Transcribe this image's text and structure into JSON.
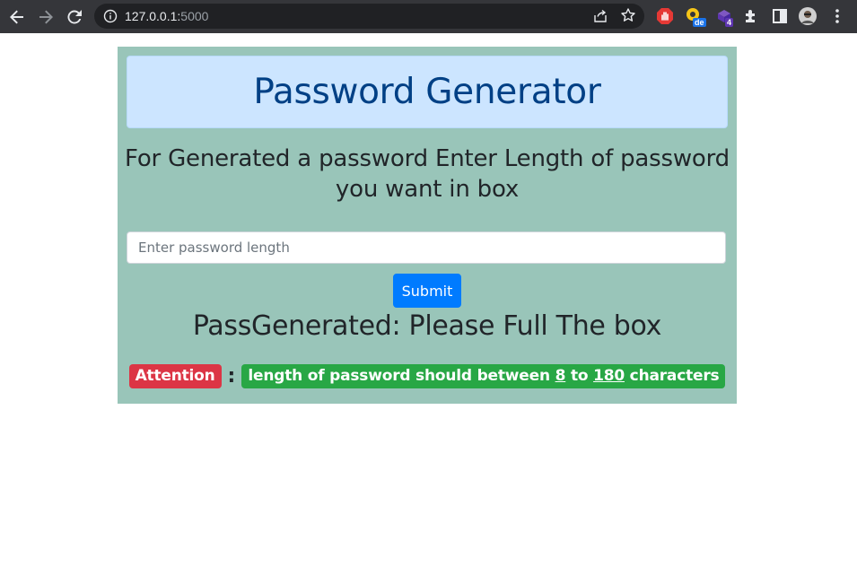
{
  "browser": {
    "url_host": "127.0.0.1:",
    "url_port": "5000",
    "extension_badges": {
      "de": "de",
      "count": "4"
    }
  },
  "page": {
    "title": "Password Generator",
    "instructions": "For Generated a password Enter Length of password you want in box",
    "input": {
      "placeholder": "Enter password length",
      "value": ""
    },
    "submit_label": "Submit",
    "result_text": "PassGenerated: Please Full The box",
    "attention_label": "Attention",
    "separator": ":",
    "note": {
      "prefix": "length of password should between ",
      "min": "8",
      "middle": " to ",
      "max": "180",
      "suffix": " characters"
    }
  },
  "colors": {
    "card_bg": "#99c5b9",
    "header_bg": "#cce5ff",
    "header_text": "#004085",
    "primary": "#007bff",
    "danger": "#dc3545",
    "success": "#28a745"
  }
}
